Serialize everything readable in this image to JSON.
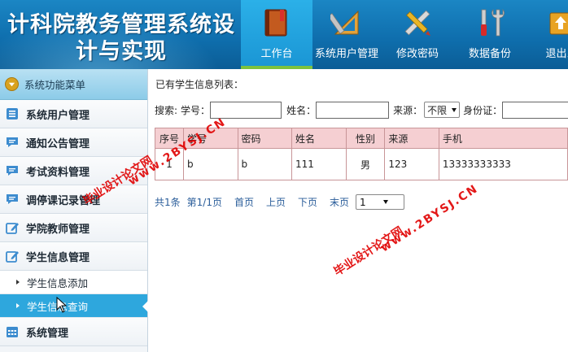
{
  "header": {
    "title_line1": "计科院教务管理系统设",
    "title_line2": "计与实现",
    "nav": [
      {
        "label": "工作台",
        "icon": "book-icon",
        "active": true
      },
      {
        "label": "系统用户管理",
        "icon": "ruler-triangle-icon",
        "active": false
      },
      {
        "label": "修改密码",
        "icon": "pencil-ruler-icon",
        "active": false
      },
      {
        "label": "数据备份",
        "icon": "tools-icon",
        "active": false
      },
      {
        "label": "退出系",
        "icon": "exit-icon",
        "active": false
      }
    ]
  },
  "sidebar": {
    "header": "系统功能菜单",
    "items": [
      {
        "label": "系统用户管理",
        "icon": "list-icon"
      },
      {
        "label": "通知公告管理",
        "icon": "message-icon"
      },
      {
        "label": "考试资料管理",
        "icon": "message-icon"
      },
      {
        "label": "调停课记录管理",
        "icon": "message-icon"
      },
      {
        "label": "学院教师管理",
        "icon": "edit-icon"
      },
      {
        "label": "学生信息管理",
        "icon": "edit-icon"
      }
    ],
    "sub_items": [
      {
        "label": "学生信息添加",
        "active": false
      },
      {
        "label": "学生信息查询",
        "active": true
      }
    ],
    "bottom_item": {
      "label": "系统管理",
      "icon": "calendar-icon"
    }
  },
  "content": {
    "list_title": "已有学生信息列表：",
    "search": {
      "prefix": "搜索:",
      "student_no_label": "学号：",
      "student_no_value": "",
      "name_label": "姓名：",
      "name_value": "",
      "source_label": "来源：",
      "source_selected": "不限",
      "id_label": "身份证：",
      "id_value": ""
    },
    "table": {
      "headers": [
        "序号",
        "学号",
        "密码",
        "姓名",
        "性别",
        "来源",
        "手机"
      ],
      "rows": [
        [
          "1",
          "b",
          "b",
          "111",
          "男",
          "123",
          "13333333333"
        ]
      ]
    },
    "pager": {
      "total": "共1条",
      "page": "第1/1页",
      "first": "首页",
      "prev": "上页",
      "next": "下页",
      "last": "末页",
      "page_select": "1"
    }
  },
  "watermarks": {
    "text_cn": "毕业设计论文网",
    "text_url": "www.2BYSJ.CN"
  },
  "colors": {
    "header_blue": "#0f6fae",
    "nav_active": "#1a95d4",
    "nav_active_underline": "#7cc23f",
    "sidebar_active": "#2ea7dd",
    "table_header": "#f5cfd2",
    "table_border": "#c89598",
    "watermark": "#e00000",
    "link": "#2a5d9a"
  }
}
